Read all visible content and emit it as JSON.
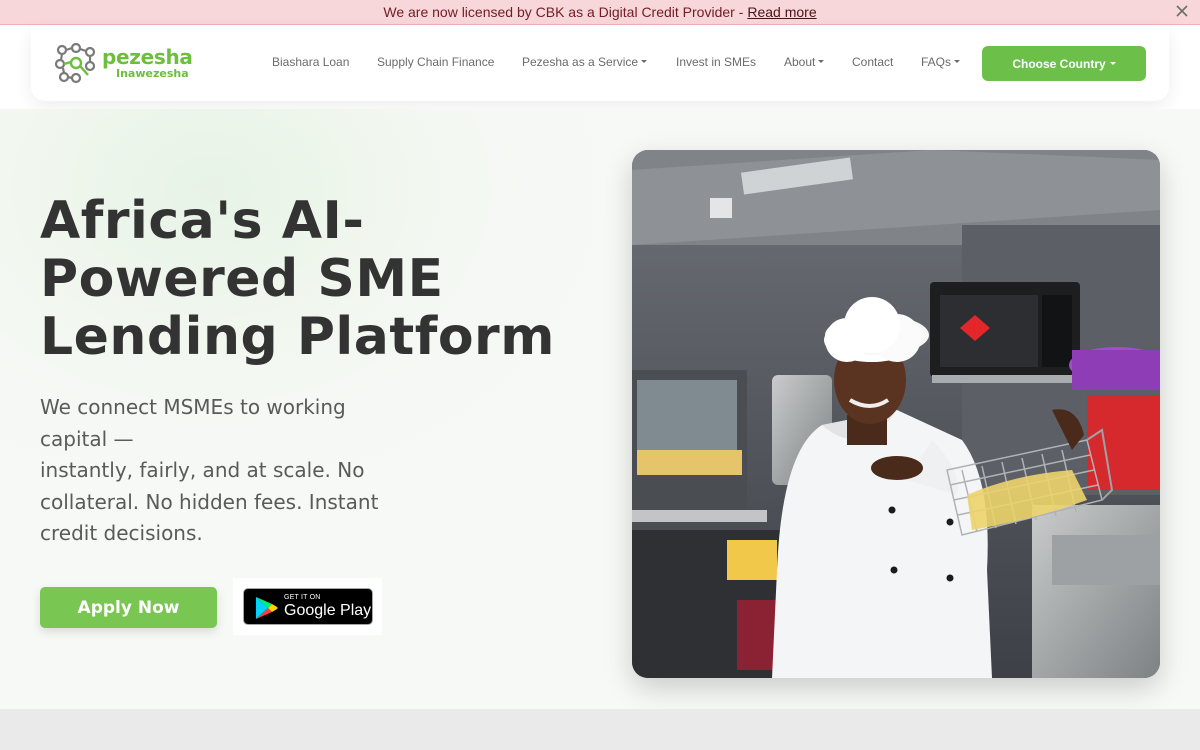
{
  "announcement": {
    "text": "We are now licensed by CBK as a Digital Credit Provider -",
    "link": "Read more",
    "close_label": "✕"
  },
  "logo": {
    "name": "pezesha",
    "tagline": "Inawezesha",
    "icon": "pezesha-logo-icon"
  },
  "nav": {
    "items": [
      {
        "label": "Biashara Loan",
        "dropdown": false
      },
      {
        "label": "Supply Chain Finance",
        "dropdown": false
      },
      {
        "label": "Pezesha as a Service",
        "dropdown": true
      },
      {
        "label": "Invest in SMEs",
        "dropdown": false
      },
      {
        "label": "About",
        "dropdown": true
      },
      {
        "label": "Contact",
        "dropdown": false
      },
      {
        "label": "FAQs",
        "dropdown": true
      }
    ],
    "country_button": "Choose Country"
  },
  "hero": {
    "headline_line1": "Africa's AI-",
    "headline_line2": "Powered SME",
    "headline_line3": "Lending Platform",
    "sub_line1": "We connect MSMEs to working capital —",
    "sub_line2": "instantly, fairly, and at scale. No collateral. No hidden fees. Instant credit decisions.",
    "apply_button": "Apply Now",
    "google_play_small": "GET IT ON",
    "google_play_large": "Google Play",
    "photo_icon": "chef-with-fryer-basket-photo"
  },
  "colors": {
    "brand_green": "#6cc04a",
    "announcement_bg": "#f8d7da",
    "headline": "#333333"
  }
}
